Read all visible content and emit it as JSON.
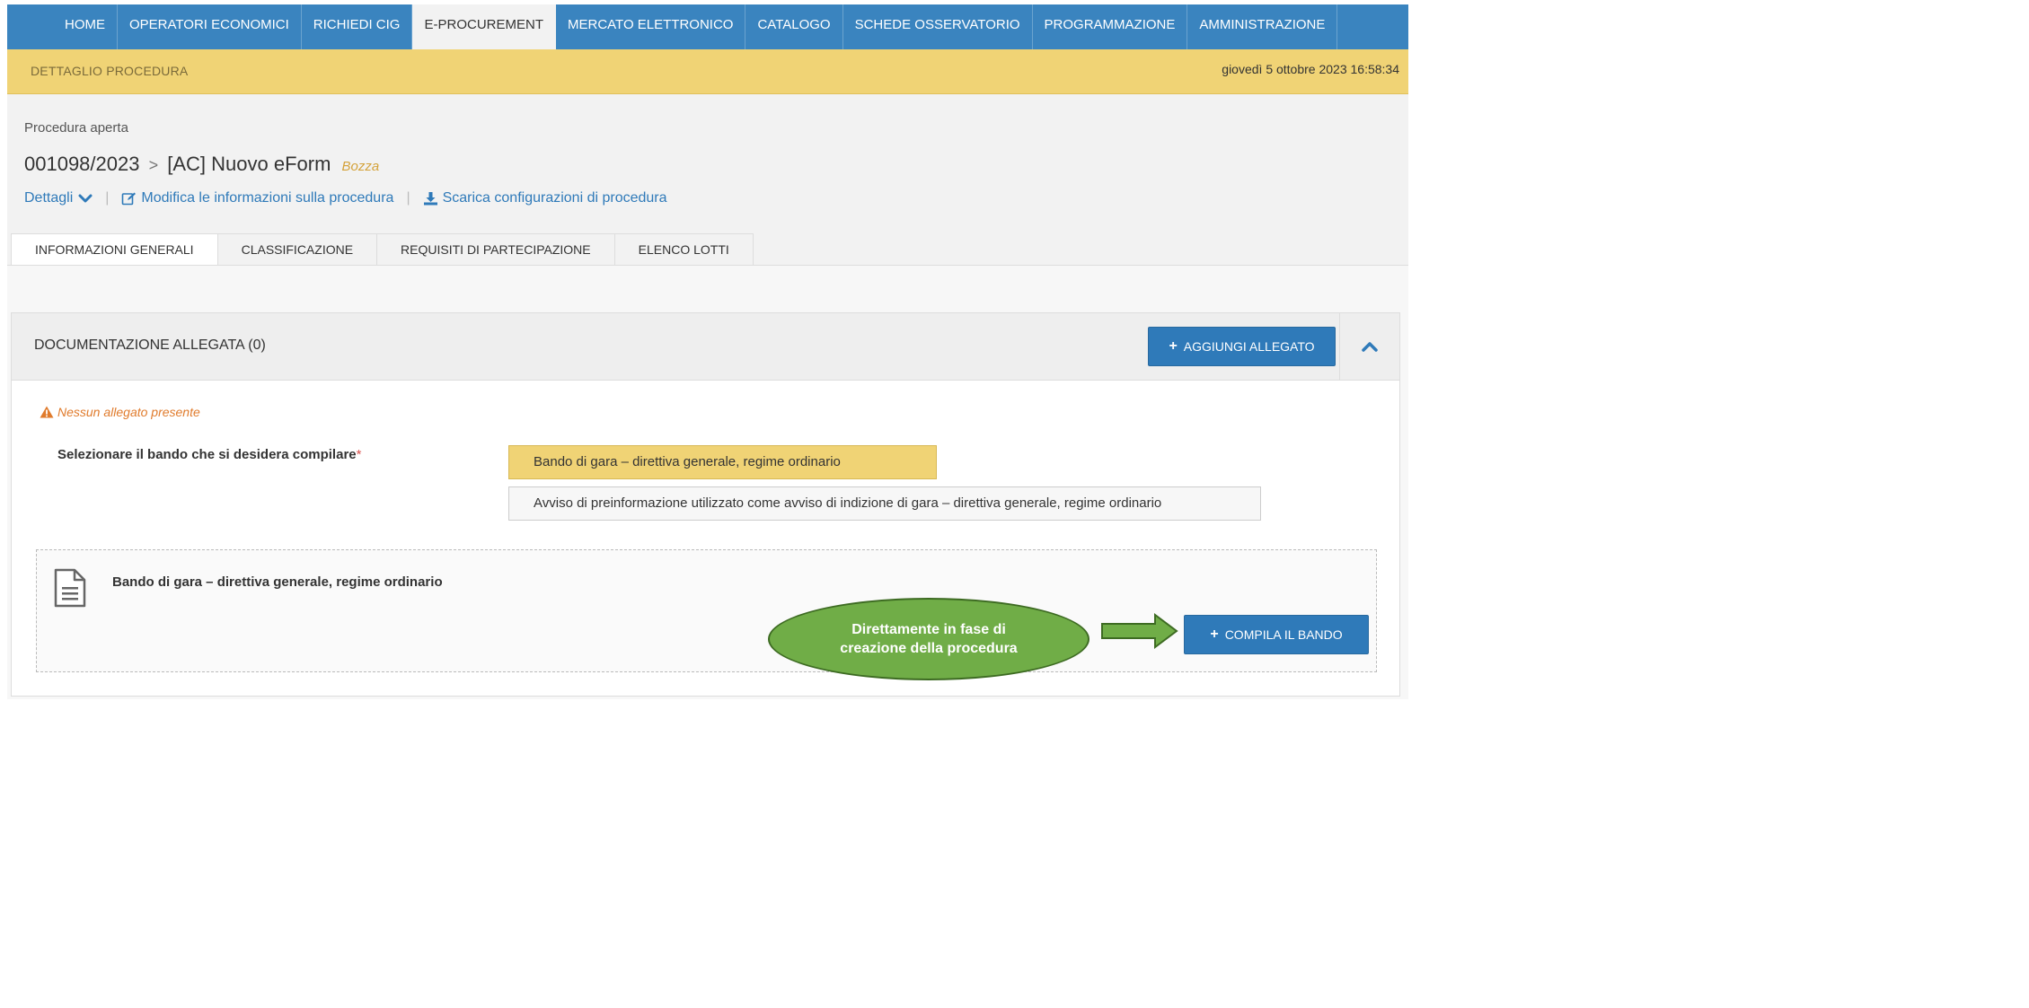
{
  "nav": {
    "items": [
      {
        "label": "HOME",
        "active": false
      },
      {
        "label": "OPERATORI ECONOMICI",
        "active": false
      },
      {
        "label": "RICHIEDI CIG",
        "active": false
      },
      {
        "label": "E-PROCUREMENT",
        "active": true
      },
      {
        "label": "MERCATO ELETTRONICO",
        "active": false
      },
      {
        "label": "CATALOGO",
        "active": false
      },
      {
        "label": "SCHEDE OSSERVATORIO",
        "active": false
      },
      {
        "label": "PROGRAMMAZIONE",
        "active": false
      },
      {
        "label": "AMMINISTRAZIONE",
        "active": false
      }
    ]
  },
  "subheader": {
    "section": "DETTAGLIO PROCEDURA",
    "datetime": "giovedì 5 ottobre 2023 16:58:34"
  },
  "procedure": {
    "type": "Procedura aperta",
    "code": "001098/2023",
    "separator": ">",
    "name": "[AC] Nuovo eForm",
    "status": "Bozza"
  },
  "actions": {
    "details": "Dettagli",
    "edit": "Modifica le informazioni sulla procedura",
    "download": "Scarica configurazioni di procedura",
    "divider": "|"
  },
  "tabs": [
    {
      "label": "INFORMAZIONI GENERALI",
      "active": true
    },
    {
      "label": "CLASSIFICAZIONE",
      "active": false
    },
    {
      "label": "REQUISITI DI PARTECIPAZIONE",
      "active": false
    },
    {
      "label": "ELENCO LOTTI",
      "active": false
    }
  ],
  "panel": {
    "title": "DOCUMENTAZIONE ALLEGATA (0)",
    "add_button": "AGGIUNGI ALLEGATO",
    "warning": "Nessun allegato presente",
    "select_label": "Selezionare il bando che si desidera compilare",
    "required_mark": "*",
    "options": [
      {
        "label": "Bando di gara – direttiva generale, regime ordinario",
        "selected": true
      },
      {
        "label": "Avviso di preinformazione utilizzato come avviso di indizione di gara – direttiva generale, regime ordinario",
        "selected": false
      }
    ],
    "selected_document": "Bando di gara – direttiva generale, regime ordinario",
    "compile_button": "COMPILA IL BANDO"
  },
  "annotation": {
    "text": "Direttamente in fase di creazione della procedura"
  },
  "colors": {
    "nav_blue": "#3a84bf",
    "subheader_yellow": "#f0d375",
    "primary_button": "#2f7ab9",
    "warning_orange": "#e07b2c",
    "status_gold": "#d4a23a",
    "annotation_green": "#70ad47"
  },
  "icons": {
    "details": "chevron-down-icon",
    "edit": "edit-icon",
    "download": "download-icon",
    "collapse": "chevron-up-icon",
    "warning": "warning-icon",
    "document": "document-icon",
    "annotation_arrow": "arrow-right-icon"
  }
}
